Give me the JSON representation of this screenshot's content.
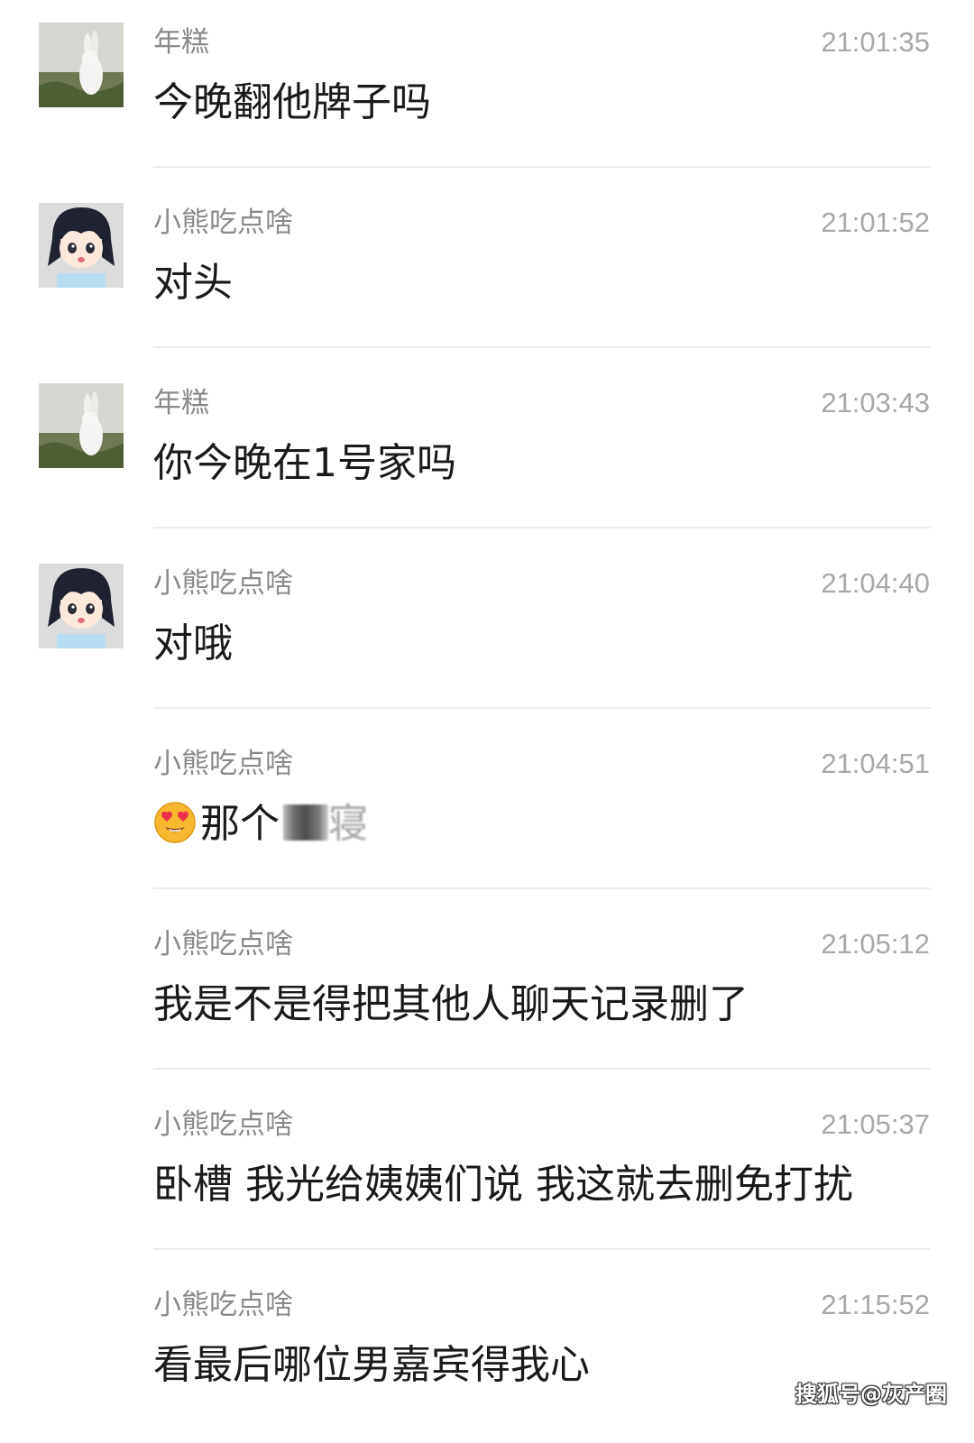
{
  "messages": [
    {
      "sender": "年糕",
      "time": "21:01:35",
      "text": "今晚翻他牌子吗",
      "avatar": "rabbit-avatar"
    },
    {
      "sender": "小熊吃点啥",
      "time": "21:01:52",
      "text": "对头",
      "avatar": "anime-girl-avatar"
    },
    {
      "sender": "年糕",
      "time": "21:03:43",
      "text": "你今晚在1号家吗",
      "avatar": "rabbit-avatar"
    },
    {
      "sender": "小熊吃点啥",
      "time": "21:04:40",
      "text": "对哦",
      "avatar": "anime-girl-avatar"
    },
    {
      "sender": "小熊吃点啥",
      "time": "21:04:51",
      "text": "那个",
      "text_tail": "寝",
      "emoji": "heart-eyes-emoji",
      "redacted": true
    },
    {
      "sender": "小熊吃点啥",
      "time": "21:05:12",
      "text": "我是不是得把其他人聊天记录删了"
    },
    {
      "sender": "小熊吃点啥",
      "time": "21:05:37",
      "text": "卧槽 我光给姨姨们说 我这就去删免打扰"
    },
    {
      "sender": "小熊吃点啥",
      "time": "21:15:52",
      "text": "看最后哪位男嘉宾得我心"
    }
  ],
  "watermark": "搜狐号@灰产圈",
  "colors": {
    "background": "#ffffff",
    "sender": "#8a8a8a",
    "time": "#a8a8a8",
    "text": "#1a1a1a",
    "divider": "#ececec"
  }
}
